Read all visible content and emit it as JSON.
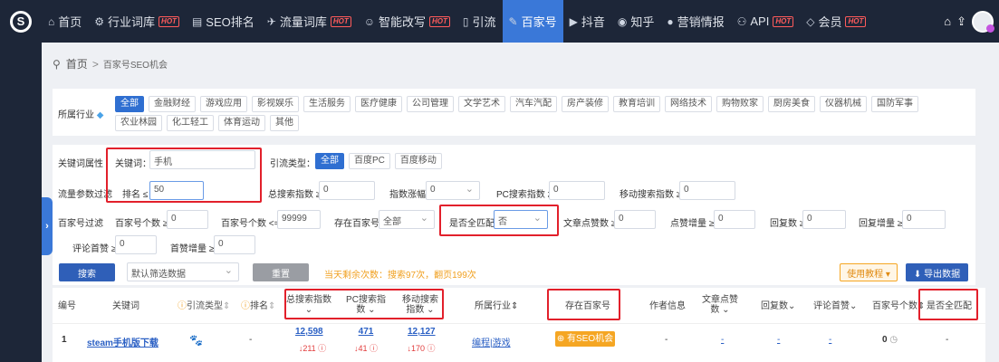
{
  "nav": {
    "items": [
      {
        "icon": "home-icon",
        "glyph": "⌂",
        "label": "首页",
        "hot": ""
      },
      {
        "icon": "industry-icon",
        "glyph": "⚙",
        "label": "行业词库",
        "hot": "HOT"
      },
      {
        "icon": "seo-icon",
        "glyph": "▤",
        "label": "SEO排名",
        "hot": ""
      },
      {
        "icon": "traffic-icon",
        "glyph": "✈",
        "label": "流量词库",
        "hot": "HOT"
      },
      {
        "icon": "ai-icon",
        "glyph": "☺",
        "label": "智能改写",
        "hot": "HOT"
      },
      {
        "icon": "redirect-icon",
        "glyph": "▯",
        "label": "引流",
        "hot": ""
      },
      {
        "icon": "baijiahao-icon",
        "glyph": "✎",
        "label": "百家号",
        "hot": ""
      },
      {
        "icon": "douyin-icon",
        "glyph": "▶",
        "label": "抖音",
        "hot": ""
      },
      {
        "icon": "zhihu-icon",
        "glyph": "◉",
        "label": "知乎",
        "hot": ""
      },
      {
        "icon": "marketing-icon",
        "glyph": "●",
        "label": "营销情报",
        "hot": ""
      },
      {
        "icon": "api-icon",
        "glyph": "⚇",
        "label": "API",
        "hot": "HOT"
      },
      {
        "icon": "vip-icon",
        "glyph": "◇",
        "label": "会员",
        "hot": "HOT"
      }
    ],
    "active_index": 6
  },
  "breadcrumb": {
    "home": "首页",
    "sep": ">",
    "current": "百家号SEO机会"
  },
  "industry": {
    "label": "所属行业",
    "tags": [
      "全部",
      "金融财经",
      "游戏应用",
      "影视娱乐",
      "生活服务",
      "医疗健康",
      "公司管理",
      "文学艺术",
      "汽车汽配",
      "房产装修",
      "教育培训",
      "网络技术",
      "购物败家",
      "厨房美食",
      "仪器机械",
      "国防军事",
      "农业林园",
      "化工轻工",
      "体育运动",
      "其他"
    ]
  },
  "filters": {
    "keyword_attr_label": "关键词属性",
    "keyword_label": "关键词：",
    "keyword_value": "手机",
    "traffic_type_label": "引流类型：",
    "traffic_types": [
      "全部",
      "百度PC",
      "百度移动"
    ],
    "traffic_param_label": "流量参数过滤",
    "rank_label": "排名 ≤",
    "rank_value": "50",
    "total_index_label": "总搜索指数 ≥",
    "total_index_value": "0",
    "index_growth_label": "指数涨幅",
    "index_growth_value": "0",
    "pc_index_label": "PC搜索指数 ≥",
    "pc_index_value": "0",
    "mobile_index_label": "移动搜索指数 ≥",
    "mobile_index_value": "0",
    "bjh_filter_label": "百家号过滤",
    "bjh_count_min_label": "百家号个数 ≥",
    "bjh_count_min_value": "0",
    "bjh_count_max_label": "百家号个数 <=",
    "bjh_count_max_value": "99999",
    "exists_label": "存在百家号",
    "exists_value": "全部",
    "full_match_label": "是否全匹配",
    "full_match_value": "否",
    "article_likes_label": "文章点赞数 ≥",
    "article_likes_value": "0",
    "likes_growth_label": "点赞增量 ≥",
    "likes_growth_value": "0",
    "replies_label": "回复数 ≥",
    "replies_value": "0",
    "reply_growth_label": "回复增量 ≥",
    "reply_growth_value": "0",
    "comment_first_label": "评论首赞 ≥",
    "comment_first_value": "0",
    "first_like_label": "首赞增量 ≥",
    "first_like_value": "0"
  },
  "actions": {
    "search": "搜索",
    "default_filter": "默认筛选数据",
    "reset": "重置",
    "quota": "当天剩余次数：搜索97次，翻页199次",
    "tutorial": "使用教程 ▾",
    "export": "⬇ 导出数据"
  },
  "table": {
    "headers": {
      "no": "编号",
      "keyword": "关键词",
      "traffic_type": "引流类型",
      "rank": "排名",
      "total_index": "总搜索指数",
      "pc_index": "PC搜索指数",
      "mobile_index": "移动搜索指数",
      "industry": "所属行业",
      "exists": "存在百家号",
      "author": "作者信息",
      "likes": "文章点赞数",
      "replies": "回复数",
      "first_like": "评论首赞",
      "bjh_count": "百家号个数",
      "full_match": "是否全匹配"
    },
    "rows": [
      {
        "no": "1",
        "keyword": "steam手机版下载",
        "traffic_icon": "baidu-paw-icon",
        "rank": "-",
        "total_index": "12,598",
        "total_delta": "211",
        "pc_index": "471",
        "pc_delta": "41",
        "mobile_index": "12,127",
        "mobile_delta": "170",
        "industry": "编程|游戏",
        "exists": "⊕ 有SEO机会",
        "author": "-",
        "likes": "-",
        "replies": "-",
        "first_like": "-",
        "bjh_count": "0",
        "full_match": "-"
      }
    ]
  },
  "colors": {
    "nav_bg": "#1d2638",
    "accent": "#2f6fd1",
    "red_highlight": "#e2202b",
    "opportunity": "#f5a623"
  }
}
